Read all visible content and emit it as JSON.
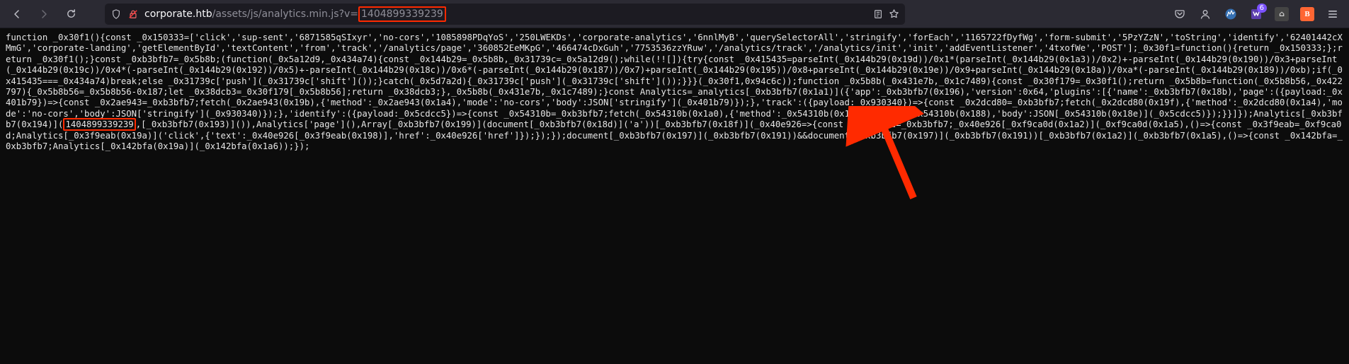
{
  "url": {
    "prefix": "",
    "host": "corporate.htb",
    "path": "/assets/js/analytics.min.js?v=",
    "query_highlight": "1404899339239"
  },
  "highlight_value": "1404899339239",
  "ext_badge": "6",
  "code": {
    "pre": "function _0x30f1(){const _0x150333=['click','sup-sent','6871585qSIxyr','no-cors','1085898PDqYoS','250LWEKDs','corporate-analytics','6nnlMyB','querySelectorAll','stringify','forEach','1165722fDyfWg','form-submit','5PzYZzN','toString','identify','62401442cXMmG','corporate-landing','getElementById','textContent','from','track','/analytics/page','360852EeMKpG','466474cDxGuh','7753536zzYRuw','/analytics/track','/analytics/init','init','addEventListener','4txofWe','POST'];_0x30f1=function(){return _0x150333;};return _0x30f1();}const _0xb3bfb7=_0x5b8b;(function(_0x5a12d9,_0x434a74){const _0x144b29=_0x5b8b,_0x31739c=_0x5a12d9();while(!![]){try{const _0x415435=parseInt(_0x144b29(0x19d))/0x1*(parseInt(_0x144b29(0x1a3))/0x2)+-parseInt(_0x144b29(0x190))/0x3+parseInt(_0x144b29(0x19c))/0x4*(-parseInt(_0x144b29(0x192))/0x5)+-parseInt(_0x144b29(0x18c))/0x6*(-parseInt(_0x144b29(0x187))/0x7)+parseInt(_0x144b29(0x195))/0x8+parseInt(_0x144b29(0x19e))/0x9+parseInt(_0x144b29(0x18a))/0xa*(-parseInt(_0x144b29(0x189))/0xb);if(_0x415435===_0x434a74)break;else _0x31739c['push'](_0x31739c['shift']());}catch(_0x5d7a2d){_0x31739c['push'](_0x31739c['shift']());}}}(_0x30f1,0x94c6c));function _0x5b8b(_0x431e7b,_0x1c7489){const _0x30f179=_0x30f1();return _0x5b8b=function(_0x5b8b56,_0x422797){_0x5b8b56=_0x5b8b56-0x187;let _0x38dcb3=_0x30f179[_0x5b8b56];return _0x38dcb3;},_0x5b8b(_0x431e7b,_0x1c7489);}const Analytics=_analytics[_0xb3bfb7(0x1a1)]({'app':_0xb3bfb7(0x196),'version':0x64,'plugins':[{'name':_0xb3bfb7(0x18b),'page':({payload:_0x401b79})=>{const _0x2ae943=_0xb3bfb7;fetch(_0x2ae943(0x19b),{'method':_0x2ae943(0x1a4),'mode':'no-cors','body':JSON['stringify'](_0x401b79)});},'track':({payload:_0x930340})=>{const _0x2dcd80=_0xb3bfb7;fetch(_0x2dcd80(0x19f),{'method':_0x2dcd80(0x1a4),'mode':'no-cors','body':JSON['stringify'](_0x930340)});},'identify':({payload:_0x5cdcc5})=>{const _0x54310b=_0xb3bfb7;fetch(_0x54310b(0x1a0),{'method':_0x54310b(0x1a4),'mode':_0x54310b(0x188),'body':JSON[_0x54310b(0x18e)](_0x5cdcc5)});}}]});Analytics[_0xb3bfb7(0x194)](",
    "post": ",[_0xb3bfb7(0x193)]()),Analytics['page'](),Array[_0xb3bfb7(0x199)](document[_0xb3bfb7(0x18d)]('a'))[_0xb3bfb7(0x18f)](_0x40e926=>{const _0xf9ca0d=_0xb3bfb7;_0x40e926[_0xf9ca0d(0x1a2)](_0xf9ca0d(0x1a5),()=>{const _0x3f9eab=_0xf9ca0d;Analytics[_0x3f9eab(0x19a)]('click',{'text':_0x40e926[_0x3f9eab(0x198)],'href':_0x40e926['href']});});});document[_0xb3bfb7(0x197)](_0xb3bfb7(0x191))&&document[_0xb3bfb7(0x197)](_0xb3bfb7(0x191))[_0xb3bfb7(0x1a2)](_0xb3bfb7(0x1a5),()=>{const _0x142bfa=_0xb3bfb7;Analytics[_0x142bfa(0x19a)](_0x142bfa(0x1a6));});"
  }
}
